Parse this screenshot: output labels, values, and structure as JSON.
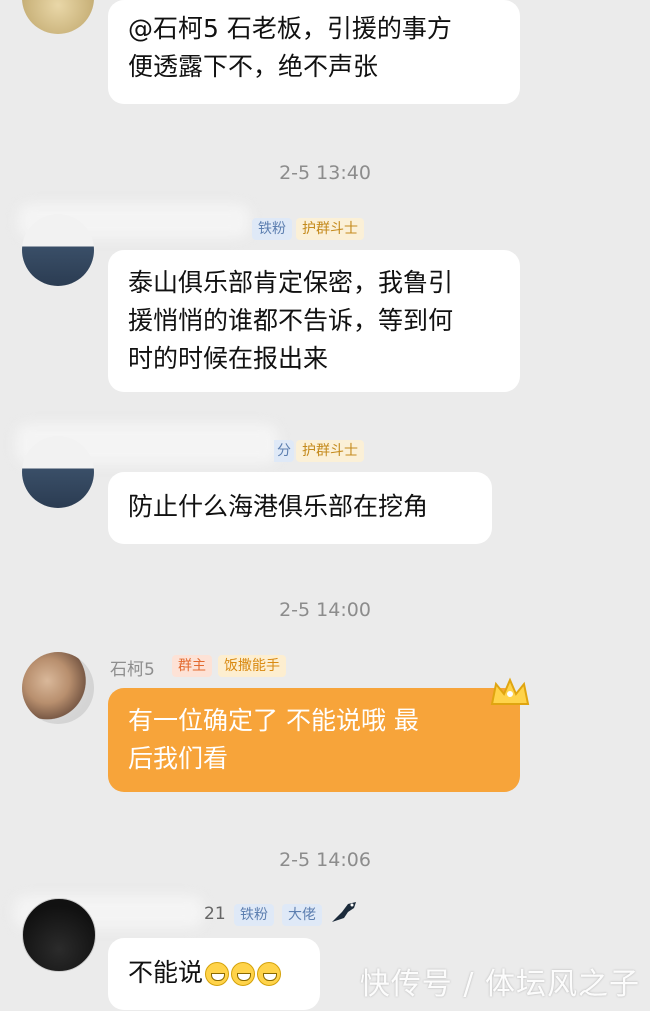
{
  "messages": [
    {
      "text_line1": "@石柯5 石老板，引援的事方",
      "text_line2": "便透露下不，绝不声张"
    },
    {
      "badges": [
        "铁粉",
        "护群斗士"
      ],
      "text_line1": "泰山俱乐部肯定保密，我鲁引",
      "text_line2": "援悄悄的谁都不告诉，等到何",
      "text_line3": "时的时候在报出来"
    },
    {
      "badge_partial": "分",
      "badges": [
        "护群斗士"
      ],
      "text": "防止什么海港俱乐部在挖角"
    },
    {
      "sender": "石柯5",
      "badges": [
        "群主",
        "饭撒能手"
      ],
      "text_line1": "有一位确定了 不能说哦 最",
      "text_line2": "后我们看"
    },
    {
      "name_partial": "21",
      "badges": [
        "铁粉",
        "大佬"
      ],
      "text": "不能说"
    }
  ],
  "timestamps": [
    "2-5 13:40",
    "2-5 14:00",
    "2-5 14:06"
  ],
  "watermark": "快传号 / 体坛风之子",
  "colors": {
    "background": "#ebebeb",
    "bubble": "#ffffff",
    "owner_bubble": "#f7a43a",
    "timestamp": "#8c8c8c"
  }
}
